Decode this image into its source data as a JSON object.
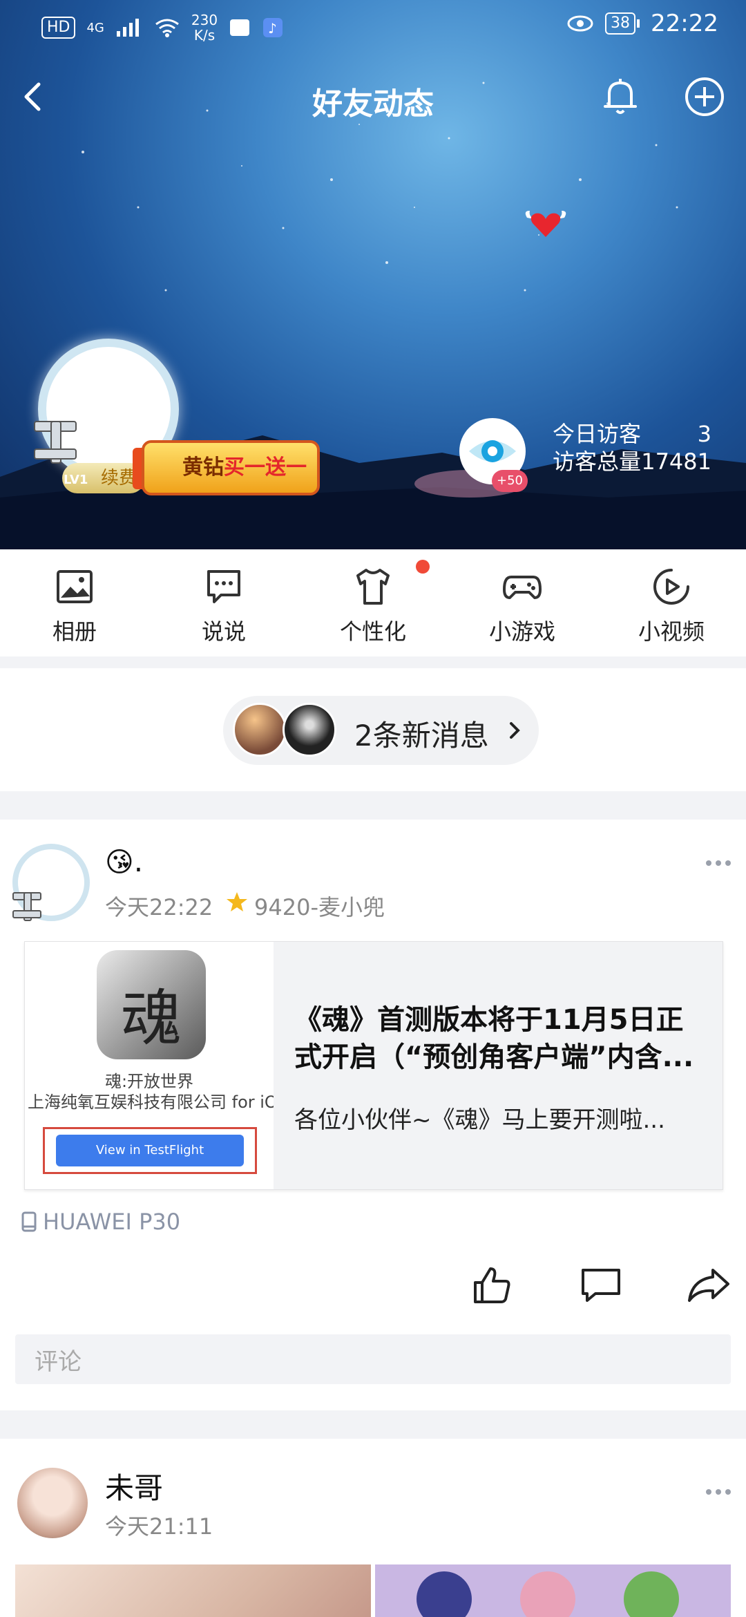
{
  "status_bar": {
    "hd": "HD",
    "net": "4G",
    "speed_top": "230",
    "speed_unit": "K/s",
    "battery": "38",
    "time": "22:22"
  },
  "header": {
    "title": "好友动态"
  },
  "profile": {
    "renew_label": "续费",
    "level": "LV1",
    "promo_prefix": "黄钻",
    "promo_highlight": "买一送一",
    "plus_badge": "+50",
    "visitors_today_label": "今日访客",
    "visitors_today_value": "3",
    "visitors_total_label": "访客总量",
    "visitors_total_value": "17481"
  },
  "quicknav": [
    {
      "label": "相册",
      "icon": "photo-icon"
    },
    {
      "label": "说说",
      "icon": "chat-bubble-icon"
    },
    {
      "label": "个性化",
      "icon": "tshirt-icon"
    },
    {
      "label": "小游戏",
      "icon": "gamepad-icon"
    },
    {
      "label": "小视频",
      "icon": "play-circle-icon"
    }
  ],
  "messages": {
    "text": "2条新消息"
  },
  "post1": {
    "name_suffix": ".",
    "time": "今天22:22",
    "tag": "9420-麦小兜",
    "share": {
      "icon_char": "魂",
      "app_name": "魂:开放世界",
      "company": "上海纯氧互娱科技有限公司 for iOS",
      "button": "View in TestFlight",
      "title": "《魂》首测版本将于11月5日正式开启（“预创角客户端”内含...",
      "desc": "各位小伙伴~《魂》马上要开测啦..."
    },
    "device": "HUAWEI P30",
    "comment_placeholder": "评论"
  },
  "post2": {
    "name": "未哥",
    "time": "今天21:11"
  },
  "colors": {
    "accent_red": "#f04a38",
    "link_blue": "#3d7cec",
    "device_gray": "#8a93a6"
  }
}
